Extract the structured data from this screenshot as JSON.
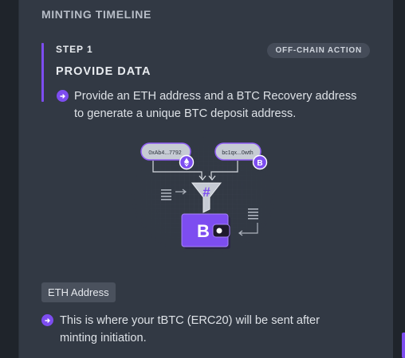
{
  "section": {
    "title": "MINTING TIMELINE"
  },
  "step": {
    "label": "STEP 1",
    "title": "PROVIDE DATA",
    "badge": "OFF-CHAIN ACTION",
    "description": "Provide an ETH address and a BTC Recovery address to generate a unique BTC deposit address."
  },
  "illustration": {
    "eth_address_preview": "0xAb4...7792",
    "btc_address_preview": "bc1qx...0wth",
    "btc_symbol": "B",
    "hash_symbol": "#"
  },
  "eth_field": {
    "label": "ETH Address",
    "description": "This is where your tBTC (ERC20) will be sent after minting initiation."
  },
  "colors": {
    "accent": "#7d4df0",
    "background": "#1f242b",
    "panel": "#323944",
    "text": "#dde1e6"
  },
  "icons": {
    "bullet": "arrow-right-circle-icon",
    "eth": "ethereum-icon",
    "btc": "bitcoin-icon",
    "hash": "hash-funnel-icon",
    "wallet": "wallet-icon"
  }
}
